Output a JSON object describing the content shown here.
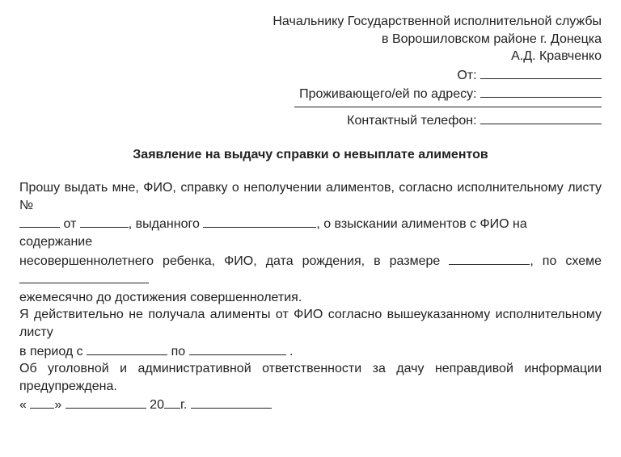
{
  "header": {
    "recipient1": "Начальнику Государственной исполнительной службы",
    "recipient2": "в Ворошиловском районе г. Донецка",
    "recipient3": "А.Д. Кравченко",
    "from_label": "От:",
    "address_label": "Проживающего/ей по адресу:",
    "phone_label": "Контактный телефон:"
  },
  "title": "Заявление на выдачу справки о невыплате алиментов",
  "body": {
    "l1": "Прошу выдать мне, ФИО, справку о неполучении алиментов, согласно исполнительному листу №",
    "l3a": "от",
    "l3b": ", выданного",
    "l3c": ", о взыскании алиментов с ФИО на содержание",
    "l4": "несовершеннолетнего ребенка, ФИО, дата рождения, в размере",
    "l4b": ", по схеме",
    "l6": "ежемесячно до достижения совершеннолетия.",
    "l7": "Я действительно не получала алименты от ФИО согласно вышеуказанному исполнительному листу",
    "l8a": "в период с",
    "l8b": "по",
    "l8c": ".",
    "l9": "Об уголовной и административной ответственности за дачу неправдивой информации",
    "l10": "предупреждена.",
    "date_open": "«",
    "date_close": "»",
    "year_prefix": "20",
    "year_suffix": "г."
  }
}
